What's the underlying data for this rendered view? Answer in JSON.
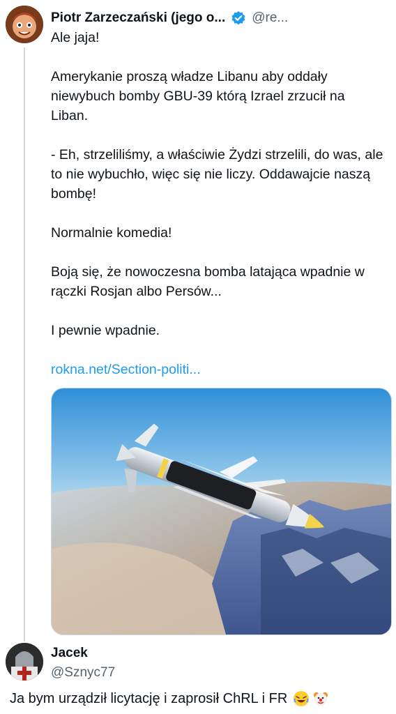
{
  "tweet": {
    "author_name": "Piotr Zarzeczański (jego o...",
    "author_handle": "@re...",
    "paragraphs": [
      "Ale jaja!",
      "Amerykanie proszą władze Libanu aby oddały niewybuch bomby GBU-39 którą Izrael zrzucił na Liban.",
      "- Eh, strzeliliśmy, a właściwie Żydzi strzelili, do was, ale to nie wybuchło, więc się nie liczy. Oddawajcie naszą bombę!",
      "Normalnie komedia!",
      "Boją się, że nowoczesna bomba latająca wpadnie w rączki Rosjan albo Persów...",
      "I pewnie wpadnie."
    ],
    "link": "rokna.net/Section-politi..."
  },
  "reply": {
    "author_name": "Jacek",
    "author_handle": "@Sznyc77",
    "text": "Ja bym urządził licytację i zaprosił ChRL i FR",
    "emojis": [
      "rolling-on-floor-laughing-emoji",
      "clown-face-emoji"
    ]
  },
  "colors": {
    "link": "#1d9bf0",
    "verified": "#1d9bf0",
    "secondary_text": "#536471",
    "thread_line": "#cfd9de"
  }
}
